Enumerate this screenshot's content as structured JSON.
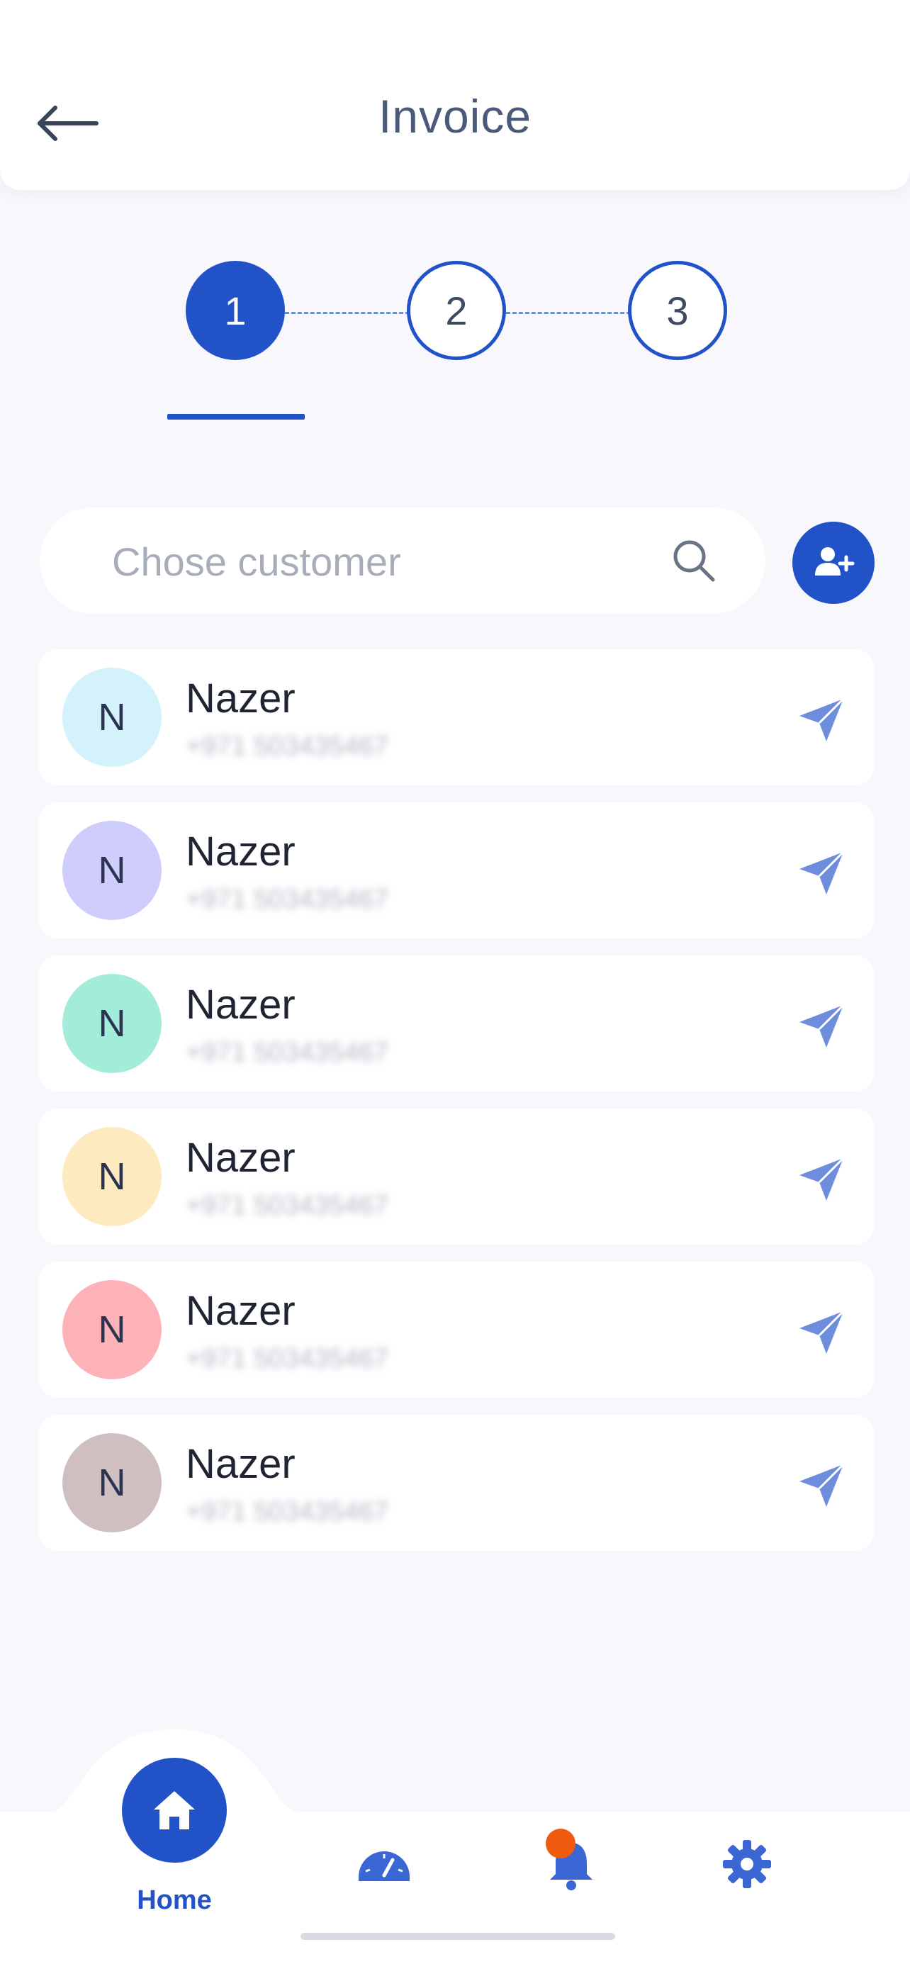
{
  "header": {
    "title": "Invoice",
    "back_icon": "arrow-left-icon"
  },
  "stepper": {
    "steps": [
      {
        "label": "1",
        "state": "active"
      },
      {
        "label": "2",
        "state": "inactive"
      },
      {
        "label": "3",
        "state": "inactive"
      }
    ]
  },
  "search": {
    "placeholder": "Chose customer",
    "value": "",
    "icon": "search-icon",
    "add_icon": "add-user-icon"
  },
  "customers": [
    {
      "initial": "N",
      "name": "Nazer",
      "phone": "+971 503435467",
      "avatar_color": "#d3f2fc"
    },
    {
      "initial": "N",
      "name": "Nazer",
      "phone": "+971 503435467",
      "avatar_color": "#cfcdfc"
    },
    {
      "initial": "N",
      "name": "Nazer",
      "phone": "+971 503435467",
      "avatar_color": "#a3ecd9"
    },
    {
      "initial": "N",
      "name": "Nazer",
      "phone": "+971 503435467",
      "avatar_color": "#fdeabf"
    },
    {
      "initial": "N",
      "name": "Nazer",
      "phone": "+971 503435467",
      "avatar_color": "#fdb2b8"
    },
    {
      "initial": "N",
      "name": "Nazer",
      "phone": "+971 503435467",
      "avatar_color": "#cfbfc1"
    }
  ],
  "nav": {
    "home_label": "Home",
    "items": [
      "home-icon",
      "speedometer-icon",
      "bell-icon",
      "gear-icon"
    ]
  },
  "colors": {
    "primary": "#2152c7",
    "send": "#6e8edb",
    "notification": "#f05a0e",
    "background": "#f8f8fc"
  }
}
